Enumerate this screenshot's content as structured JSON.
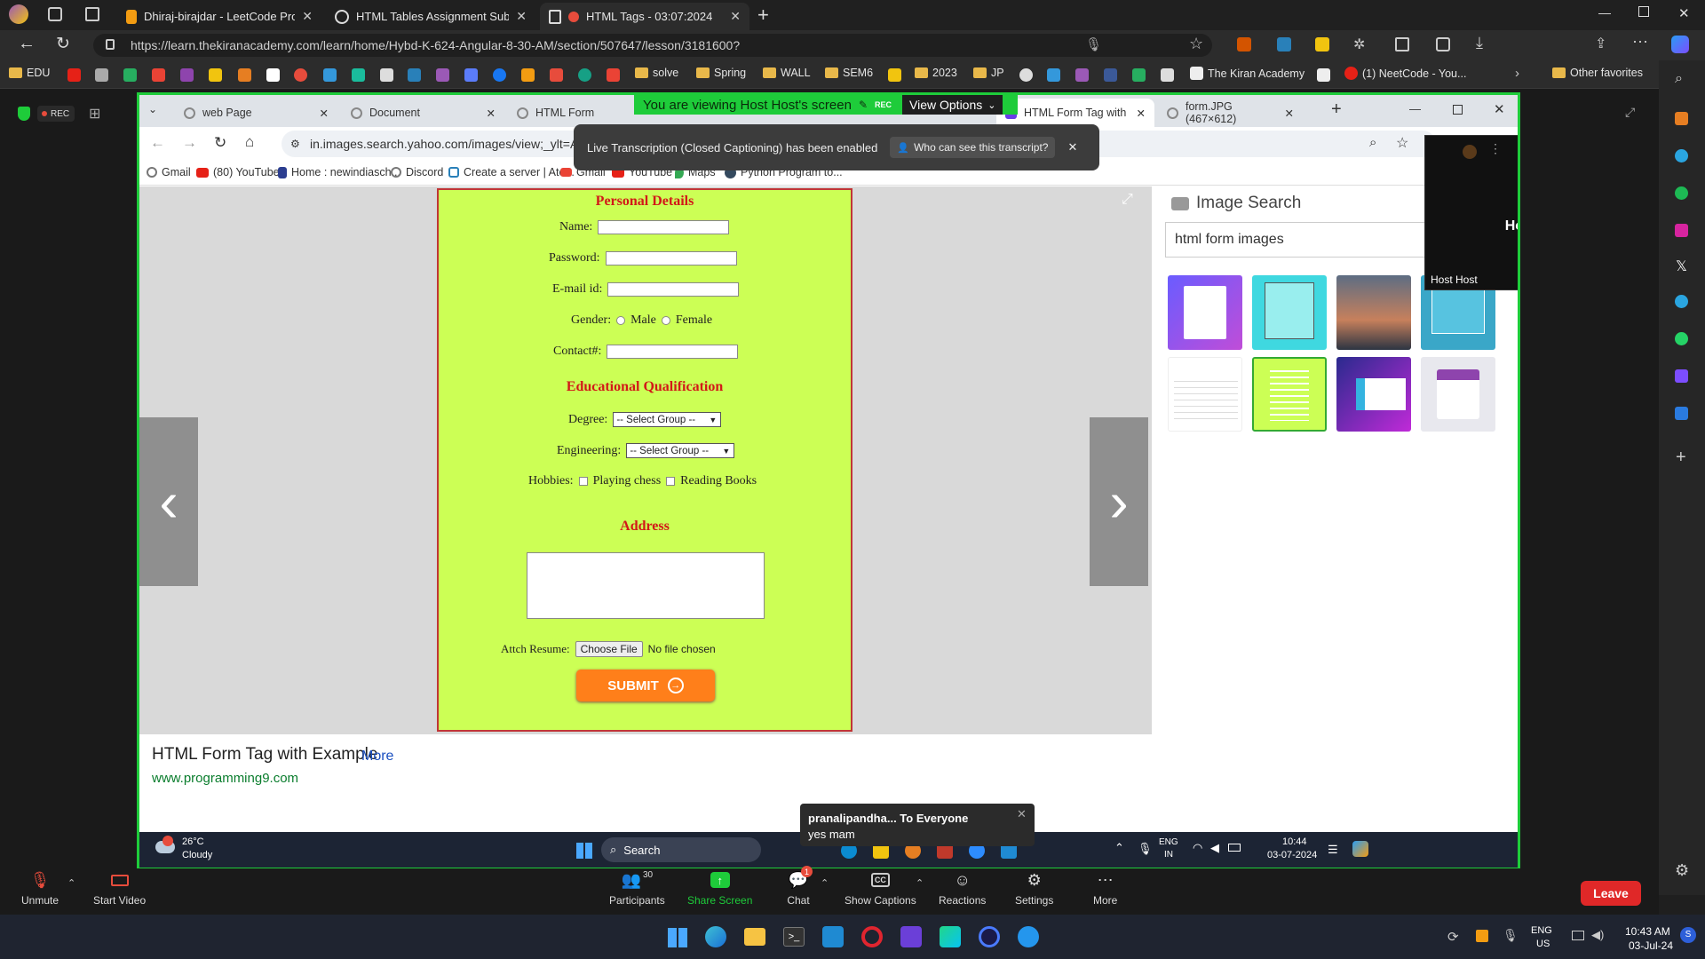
{
  "outer_tabs": [
    {
      "title": "Dhiraj-birajdar - LeetCode Profil",
      "color": "#f39c12"
    },
    {
      "title": "HTML Tables Assignment Submis",
      "color": "#ffffff"
    },
    {
      "title": "HTML Tags - 03:07:2024",
      "color": "#ffffff",
      "active": true
    }
  ],
  "outer_url": "https://learn.thekiranacademy.com/learn/home/Hybd-K-624-Angular-8-30-AM/section/507647/lesson/3181600?",
  "outer_bookmarks": [
    "EDU",
    "solve",
    "Spring",
    "WALL",
    "SEM6",
    "2023",
    "JP",
    "The Kiran Academy",
    "(1) NeetCode - You...",
    "Other favorites"
  ],
  "rec_label": "REC",
  "share_notice": "You are viewing Host Host's screen",
  "share_rec": "REC",
  "view_options": "View Options",
  "transcription": {
    "text": "Live Transcription (Closed Captioning) has been enabled",
    "link": "Who can see this transcript?"
  },
  "host_tile": {
    "name": "Host Host",
    "label": "Host Host"
  },
  "inner_tabs": [
    "web Page",
    "Document",
    "HTML Form",
    "HTML Form Tag with",
    "form.JPG (467×612)"
  ],
  "inner_url": "in.images.search.yahoo.com/images/view;_ylt=AwrPnrlb...zbjgjtNjk2MzFlMDQ2ODI1NmUzYTZkBG...",
  "inner_bookmarks": [
    "Gmail",
    "(80) YouTube",
    "Home : newindiasch...",
    "Discord",
    "Create a server | Ate...",
    "Gmail",
    "YouTube",
    "Maps",
    "Python Program to..."
  ],
  "form": {
    "personal_heading": "Personal Details",
    "name_label": "Name:",
    "password_label": "Password:",
    "email_label": "E-mail id:",
    "gender_label": "Gender:",
    "male": "Male",
    "female": "Female",
    "contact_label": "Contact#:",
    "edu_heading": "Educational Qualification",
    "degree_label": "Degree:",
    "degree_value": "-- Select Group --",
    "engineering_label": "Engineering:",
    "engineering_value": "-- Select Group --",
    "hobbies_label": "Hobbies:",
    "hobby1": "Playing chess",
    "hobby2": "Reading Books",
    "address_heading": "Address",
    "resume_label": "Attch Resume:",
    "choose_file": "Choose File",
    "no_file": "No file chosen",
    "submit": "SUBMIT"
  },
  "image_search": {
    "title": "Image Search",
    "query": "html form images"
  },
  "result": {
    "title": "HTML Form Tag with Example",
    "more": "More",
    "site": "www.programming9.com"
  },
  "inner_taskbar": {
    "weather_temp": "26°C",
    "weather_desc": "Cloudy",
    "search": "Search",
    "lang1": "ENG",
    "lang2": "IN",
    "time": "10:44",
    "date": "03-07-2024"
  },
  "chat_popup": {
    "from": "pranalipandha... To Everyone",
    "msg": "yes mam"
  },
  "zoom_controls": [
    {
      "label": "Unmute",
      "icon": "mic-muted-icon"
    },
    {
      "label": "Start Video",
      "icon": "video-off-icon"
    },
    {
      "label": "Participants",
      "icon": "participants-icon",
      "badge": "30"
    },
    {
      "label": "Share Screen",
      "icon": "share-screen-icon"
    },
    {
      "label": "Chat",
      "icon": "chat-icon",
      "badge": "1"
    },
    {
      "label": "Show Captions",
      "icon": "cc-icon"
    },
    {
      "label": "Reactions",
      "icon": "reactions-icon"
    },
    {
      "label": "Settings",
      "icon": "settings-icon"
    },
    {
      "label": "More",
      "icon": "more-icon"
    }
  ],
  "leave": "Leave",
  "outer_taskbar": {
    "lang1": "ENG",
    "lang2": "US",
    "time": "10:43 AM",
    "date": "03-Jul-24"
  }
}
